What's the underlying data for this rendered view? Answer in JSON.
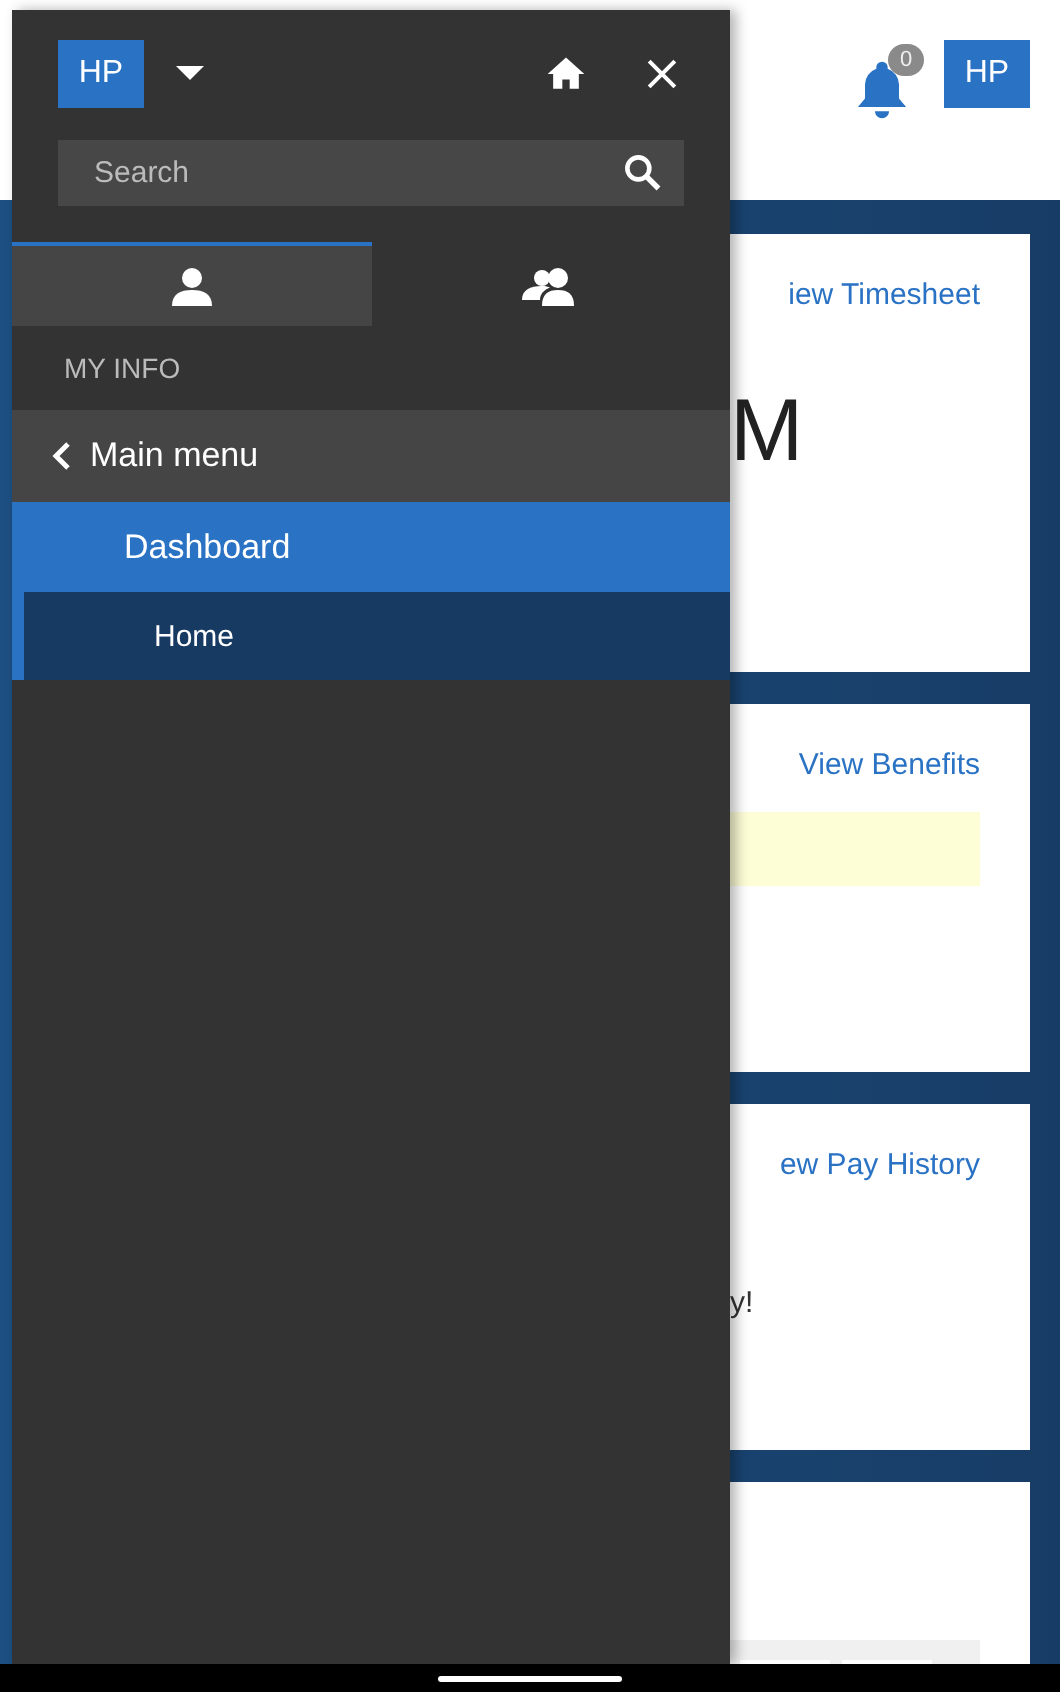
{
  "header": {
    "notification_count": "0",
    "avatar": "HP"
  },
  "cards": [
    {
      "kind": "big",
      "link": "iew Timesheet",
      "text": "M"
    },
    {
      "kind": "notice",
      "link": "View Benefits"
    },
    {
      "kind": "text",
      "link": "ew Pay History",
      "text": "y!"
    },
    {
      "kind": "table"
    }
  ],
  "drawer": {
    "avatar": "HP",
    "search": {
      "placeholder": "Search"
    },
    "tabs": [
      {
        "kind": "person",
        "selected": true
      },
      {
        "kind": "group",
        "selected": false
      }
    ],
    "section": "MY INFO",
    "back": "Main menu",
    "menu": [
      {
        "label": "Dashboard",
        "selected": true,
        "children": [
          {
            "label": "Home"
          }
        ]
      }
    ]
  }
}
